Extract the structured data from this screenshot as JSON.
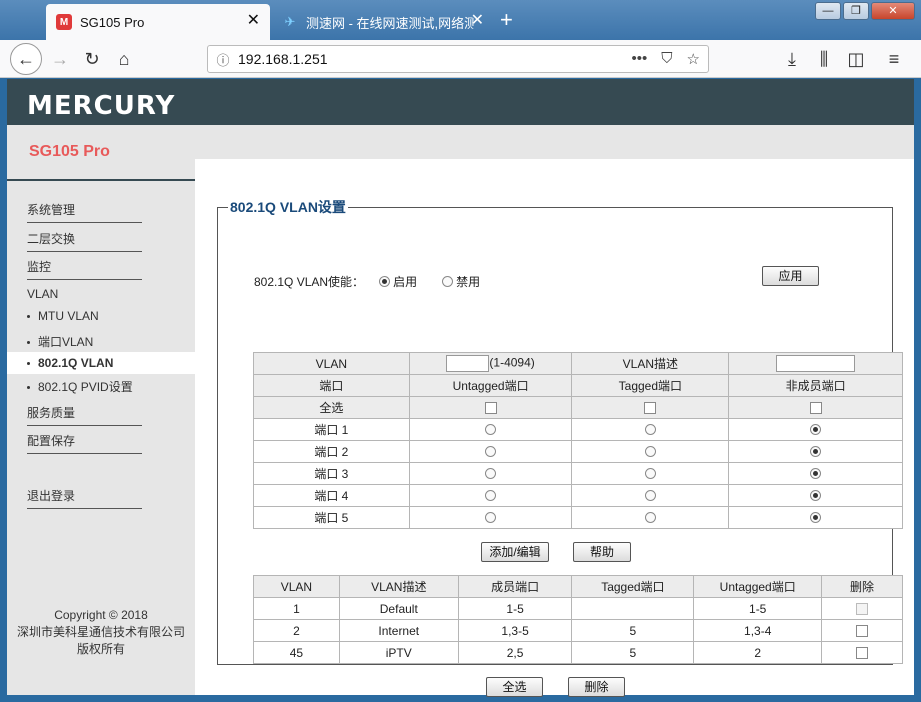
{
  "browser": {
    "tabs": [
      {
        "title": "SG105 Pro",
        "favicon": "M"
      },
      {
        "title": "测速网 - 在线网速测试,网络测速"
      }
    ],
    "url": "192.168.1.251"
  },
  "header": {
    "logo": "MERCURY",
    "model": "SG105 Pro"
  },
  "sidebar": {
    "items": [
      "系统管理",
      "二层交换",
      "监控"
    ],
    "vlan_label": "VLAN",
    "sub_items": [
      "MTU VLAN",
      "端口VLAN",
      "802.1Q VLAN",
      "802.1Q PVID设置"
    ],
    "items2": [
      "服务质量",
      "配置保存"
    ],
    "logout": "退出登录",
    "copyright": [
      "Copyright © 2018",
      "深圳市美科星通信技术有限公司",
      "版权所有"
    ]
  },
  "main": {
    "title": "802.1Q VLAN设置",
    "enable_label": "802.1Q VLAN使能：",
    "enable_on": "启用",
    "enable_off": "禁用",
    "apply_button": "应用",
    "config": {
      "vlan_label": "VLAN",
      "vlan_range": "(1-4094)",
      "desc_label": "VLAN描述",
      "port_header": "端口",
      "untagged_header": "Untagged端口",
      "tagged_header": "Tagged端口",
      "nonmember_header": "非成员端口",
      "select_all": "全选",
      "ports": [
        "端口 1",
        "端口 2",
        "端口 3",
        "端口 4",
        "端口 5"
      ]
    },
    "add_button": "添加/编辑",
    "help_button": "帮助",
    "list": {
      "headers": [
        "VLAN",
        "VLAN描述",
        "成员端口",
        "Tagged端口",
        "Untagged端口",
        "删除"
      ],
      "rows": [
        [
          "1",
          "Default",
          "1-5",
          "",
          "1-5"
        ],
        [
          "2",
          "Internet",
          "1,3-5",
          "5",
          "1,3-4"
        ],
        [
          "45",
          "iPTV",
          "2,5",
          "5",
          "2"
        ]
      ]
    },
    "select_all_button": "全选",
    "delete_button": "删除"
  }
}
